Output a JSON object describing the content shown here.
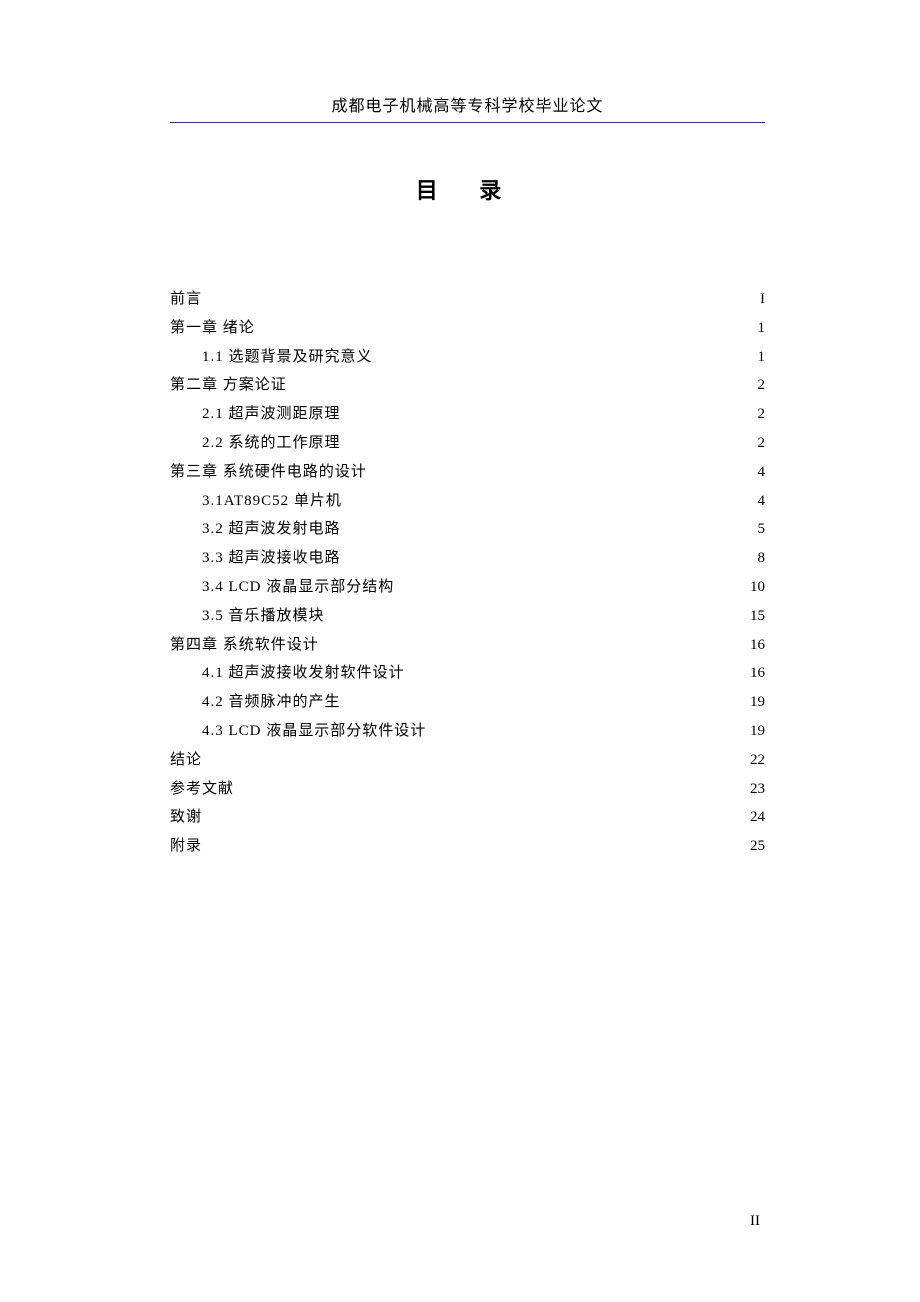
{
  "header": {
    "text": "成都电子机械高等专科学校毕业论文"
  },
  "title": "目 录",
  "toc": [
    {
      "level": 0,
      "title": "前言",
      "page": "I"
    },
    {
      "level": 0,
      "title": "第一章  绪论",
      "page": "1"
    },
    {
      "level": 1,
      "title": "1.1 选题背景及研究意义",
      "page": "1"
    },
    {
      "level": 0,
      "title": "第二章  方案论证",
      "page": "2"
    },
    {
      "level": 1,
      "title": "2.1 超声波测距原理",
      "page": "2"
    },
    {
      "level": 1,
      "title": "2.2 系统的工作原理",
      "page": "2"
    },
    {
      "level": 0,
      "title": "第三章  系统硬件电路的设计",
      "page": "4"
    },
    {
      "level": 1,
      "title": "3.1AT89C52 单片机",
      "page": "4"
    },
    {
      "level": 1,
      "title": "3.2 超声波发射电路",
      "page": "5"
    },
    {
      "level": 1,
      "title": "3.3 超声波接收电路",
      "page": "8"
    },
    {
      "level": 1,
      "title": "3.4 LCD 液晶显示部分结构",
      "page": "10"
    },
    {
      "level": 1,
      "title": "3.5 音乐播放模块",
      "page": "15"
    },
    {
      "level": 0,
      "title": "第四章  系统软件设计",
      "page": "16"
    },
    {
      "level": 1,
      "title": "4.1 超声波接收发射软件设计",
      "page": "16"
    },
    {
      "level": 1,
      "title": "4.2 音频脉冲的产生",
      "page": "19"
    },
    {
      "level": 1,
      "title": "4.3 LCD 液晶显示部分软件设计",
      "page": "19"
    },
    {
      "level": 0,
      "title": "结论",
      "page": "22"
    },
    {
      "level": 0,
      "title": "参考文献",
      "page": "23"
    },
    {
      "level": 0,
      "title": "致谢",
      "page": "24"
    },
    {
      "level": 0,
      "title": "附录",
      "page": "25"
    }
  ],
  "footer": {
    "page_number": "II"
  }
}
